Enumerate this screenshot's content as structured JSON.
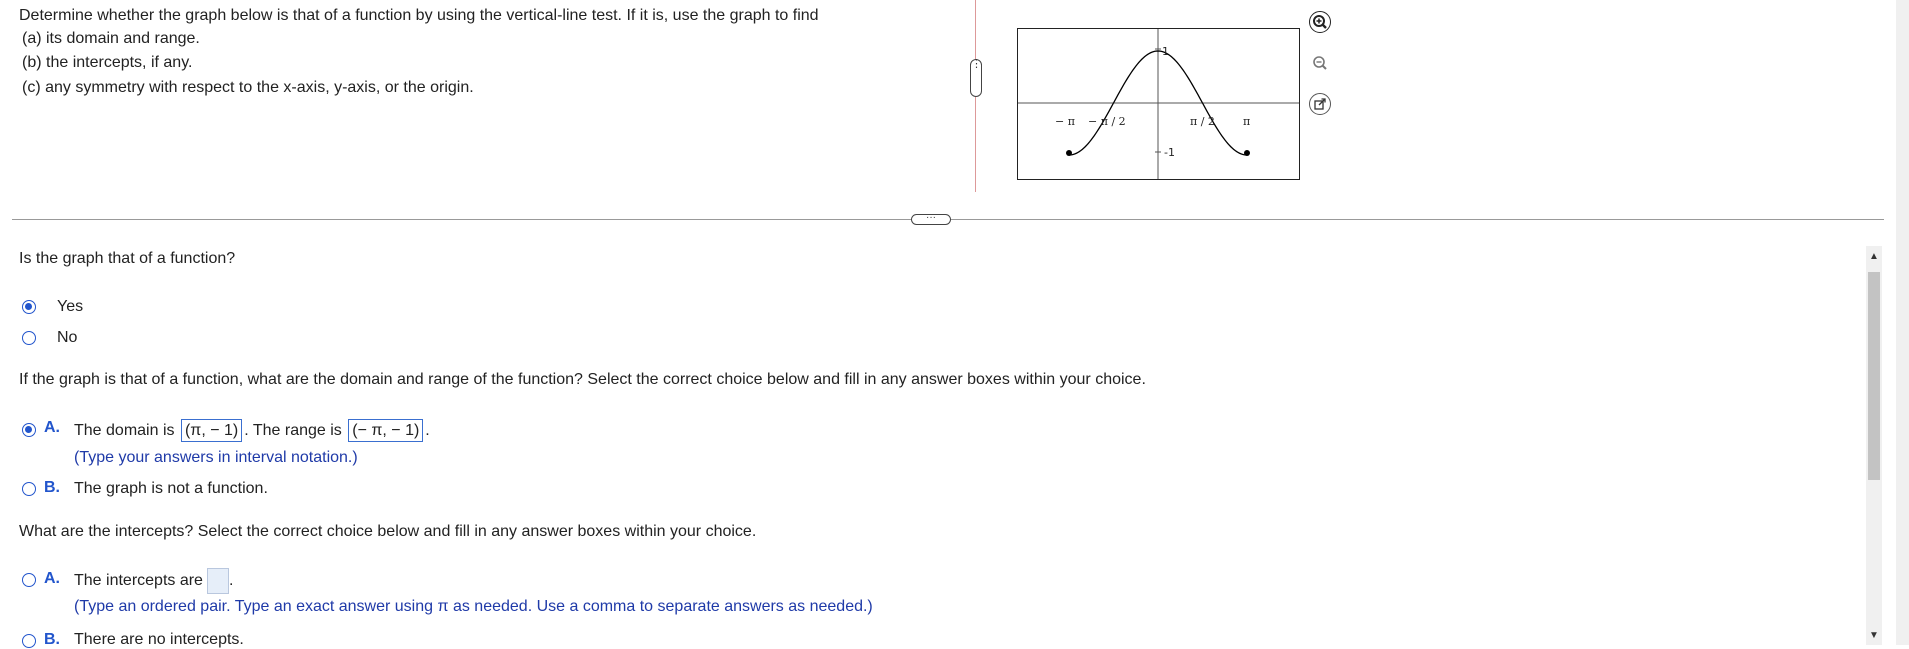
{
  "question": {
    "intro": "Determine whether the graph below is that of a function by using the vertical-line test.  If it is, use the graph to find",
    "part_a": "(a) its domain and range.",
    "part_b": "(b) the intercepts, if any.",
    "part_c": "(c) any symmetry with respect to the x-axis, y-axis, or the origin."
  },
  "graph": {
    "tick_neg_pi": "− π",
    "tick_neg_half_pi": "− π / 2",
    "tick_half_pi": "π / 2",
    "tick_pi": "π",
    "y_max_label": "1",
    "y_min_label": "-1",
    "curve_color": "#000000"
  },
  "tools": {
    "zoom_in_icon": "zoom-in-icon",
    "zoom_out_icon": "zoom-out-icon",
    "popout_icon": "external-link-icon"
  },
  "part1": {
    "prompt": "Is the graph that of a function?",
    "options": [
      {
        "label": "Yes",
        "selected": true
      },
      {
        "label": "No",
        "selected": false
      }
    ]
  },
  "part2": {
    "prompt": "If the graph is that of a function, what are the domain and range of the function? Select the correct choice below and fill in any answer boxes within your choice.",
    "choice_a": {
      "letter": "A.",
      "text_domain": "The domain is",
      "domain_value": "(π, − 1)",
      "text_range": "The range is",
      "range_value": "(− π, − 1)",
      "end": ".",
      "hint": "(Type your answers in interval notation.)",
      "selected": true
    },
    "choice_b": {
      "letter": "B.",
      "text": "The graph is not a function.",
      "selected": false
    }
  },
  "part3": {
    "prompt": "What are the intercepts? Select the correct choice below and fill in any answer boxes within your choice.",
    "choice_a": {
      "letter": "A.",
      "text": "The intercepts are",
      "end": ".",
      "hint": "(Type an ordered pair. Type an exact answer using π as needed. Use a comma to separate answers as needed.)",
      "selected": false
    },
    "choice_b": {
      "letter": "B.",
      "text": "There are no intercepts.",
      "selected": false
    }
  },
  "colors": {
    "accent": "#2255cc",
    "hint": "#1f3aa8",
    "divider": "#999999"
  }
}
